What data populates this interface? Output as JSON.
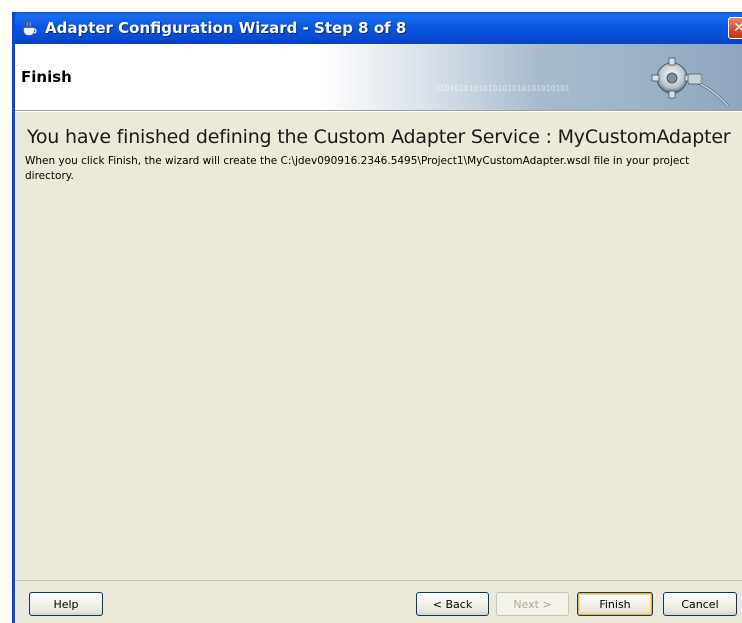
{
  "window": {
    "title": "Adapter Configuration Wizard - Step 8 of 8",
    "close_symbol": "✕"
  },
  "header": {
    "title": "Finish",
    "decor_binary": "0101010101010101010101010101",
    "graphic_icon": "gear-plug-icon"
  },
  "content": {
    "heading": "You have finished defining the Custom Adapter Service : MyCustomAdapter",
    "description": "When you click Finish, the wizard will create the C:\\jdev090916.2346.5495\\Project1\\MyCustomAdapter.wsdl file in your project directory."
  },
  "buttons": {
    "help": "Help",
    "back": "< Back",
    "next": "Next >",
    "finish": "Finish",
    "cancel": "Cancel"
  },
  "colors": {
    "titlebar": "#0A4BD6",
    "dialog_bg": "#ECE9D8",
    "close": "#D54A22"
  }
}
